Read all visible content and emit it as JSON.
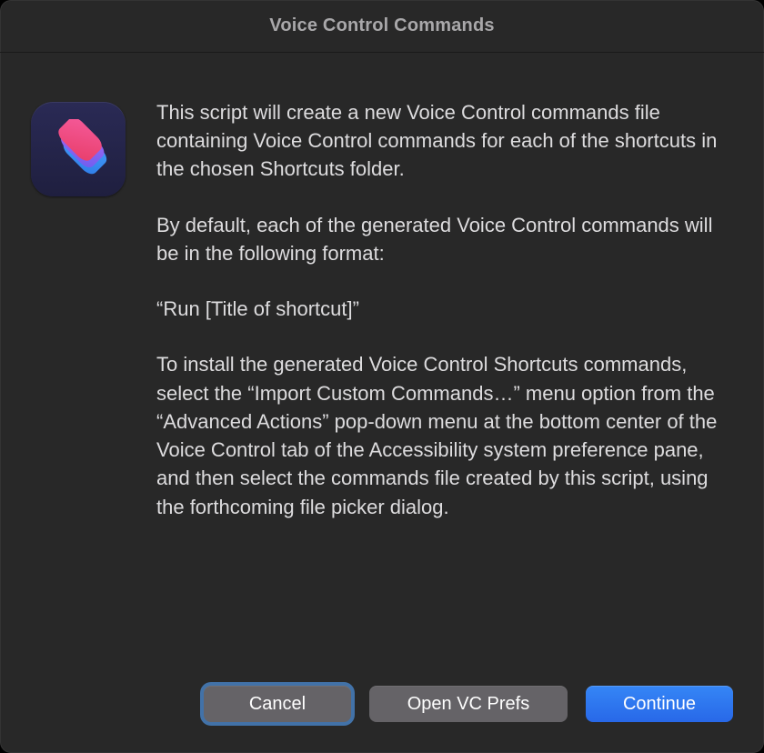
{
  "dialog": {
    "title": "Voice Control Commands",
    "icon_name": "shortcuts-app-icon",
    "paragraphs": {
      "p1": "This script will create a new Voice Control commands file containing Voice Control commands for each of the shortcuts in the chosen Shortcuts folder.",
      "p2": "By default, each of the generated Voice Control commands will be in the following format:",
      "p3": "“Run [Title of shortcut]”",
      "p4": "To install the generated Voice Control Shortcuts commands, select the “Import Custom Commands…” menu option from the “Advanced Actions” pop-down menu at the bottom center of the Voice Control tab of the Accessibility system preference pane, and then select the commands file created by this script, using the forthcoming file picker dialog."
    },
    "buttons": {
      "cancel": "Cancel",
      "open_prefs": "Open VC Prefs",
      "continue": "Continue"
    }
  }
}
